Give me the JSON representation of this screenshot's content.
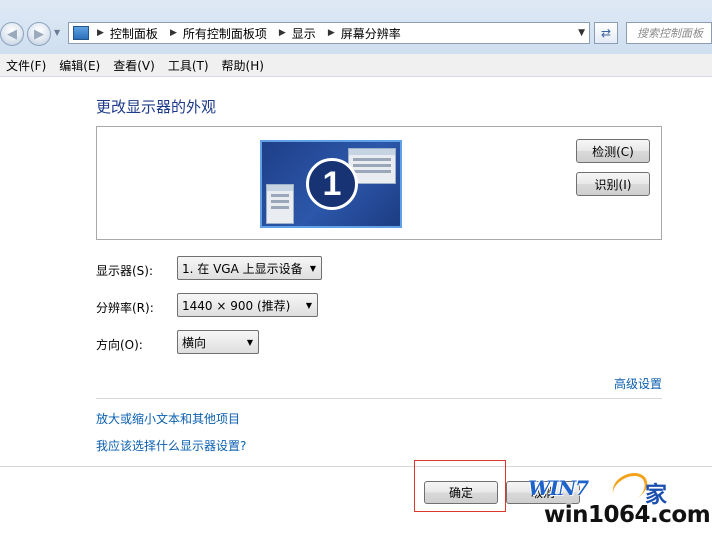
{
  "address_bar": {
    "breadcrumbs": [
      "控制面板",
      "所有控制面板项",
      "显示",
      "屏幕分辨率"
    ],
    "search_placeholder": "搜索控制面板"
  },
  "menu": {
    "items": [
      "文件(F)",
      "编辑(E)",
      "查看(V)",
      "工具(T)",
      "帮助(H)"
    ]
  },
  "main": {
    "heading": "更改显示器的外观",
    "monitor_number": "1",
    "detect_button": "检测(C)",
    "identify_button": "识别(I)",
    "display_label": "显示器(S):",
    "display_value": "1. 在 VGA 上显示设备",
    "resolution_label": "分辨率(R):",
    "resolution_value": "1440 × 900 (推荐)",
    "orientation_label": "方向(O):",
    "orientation_value": "横向",
    "advanced_link": "高级设置",
    "link_text_size": "放大或缩小文本和其他项目",
    "link_which_settings": "我应该选择什么显示器设置?"
  },
  "footer": {
    "ok_button": "确定",
    "cancel_button": "取消"
  },
  "watermark": {
    "logo_text": "WIN7",
    "home_char": "家",
    "site": "win1064.com"
  }
}
